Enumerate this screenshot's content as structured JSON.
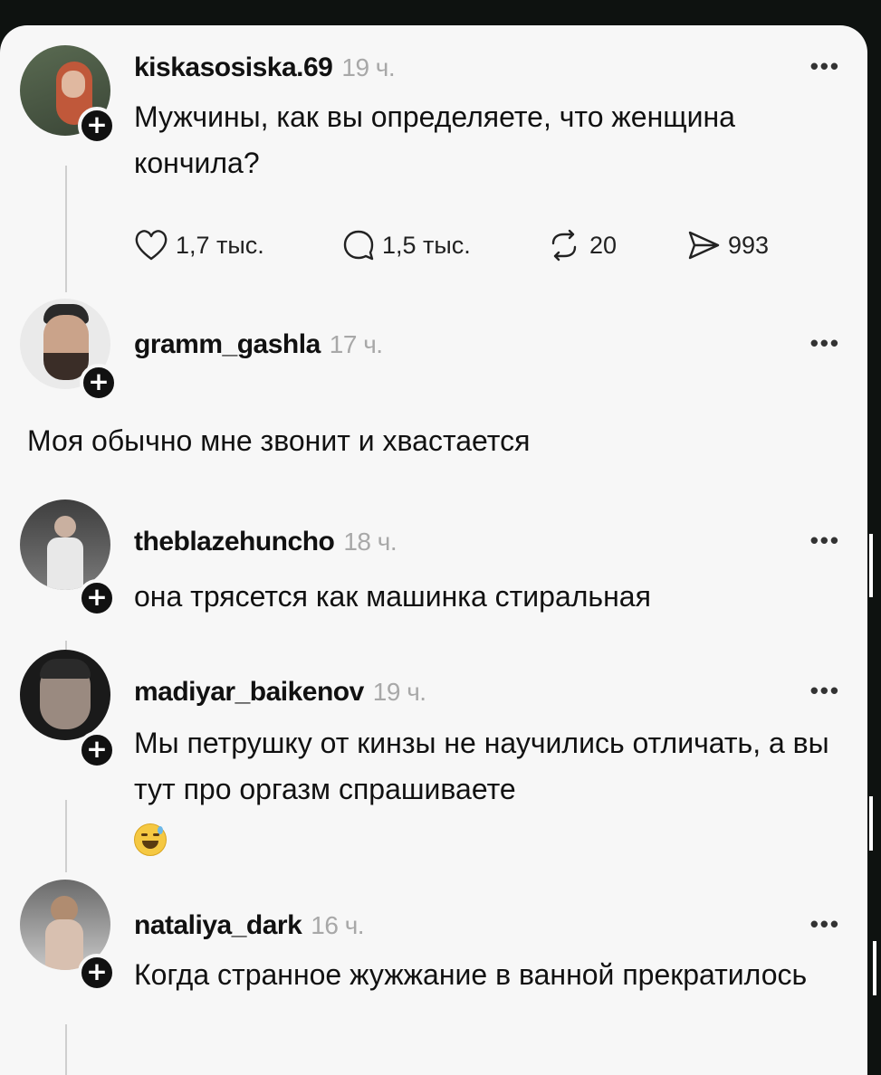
{
  "posts": [
    {
      "username": "kiskasosiska.69",
      "time": "19 ч.",
      "more": "•••",
      "text": "Мужчины, как вы определяете, что женщина кончила?",
      "actions": {
        "likes": "1,7 тыс.",
        "comments": "1,5 тыс.",
        "reposts": "20",
        "shares": "993"
      }
    },
    {
      "username": "gramm_gashla",
      "time": "17 ч.",
      "more": "•••",
      "text": "Моя обычно мне звонит и хвастается"
    },
    {
      "username": "theblazehuncho",
      "time": "18 ч.",
      "more": "•••",
      "text": "она трясется как машинка стиральная"
    },
    {
      "username": "madiyar_baikenov",
      "time": "19 ч.",
      "more": "•••",
      "text": "Мы петрушку от кинзы не научились отличать, а вы тут про оргазм спрашиваете"
    },
    {
      "username": "nataliya_dark",
      "time": "16 ч.",
      "more": "•••",
      "text": "Когда странное жужжание в ванной прекратилось"
    }
  ],
  "icons": {
    "follow": "plus-icon",
    "like": "heart-icon",
    "comment": "comment-icon",
    "repost": "repost-icon",
    "share": "send-icon"
  },
  "colors": {
    "background": "#f7f7f7",
    "text": "#111111",
    "muted": "#a8a8a8"
  }
}
